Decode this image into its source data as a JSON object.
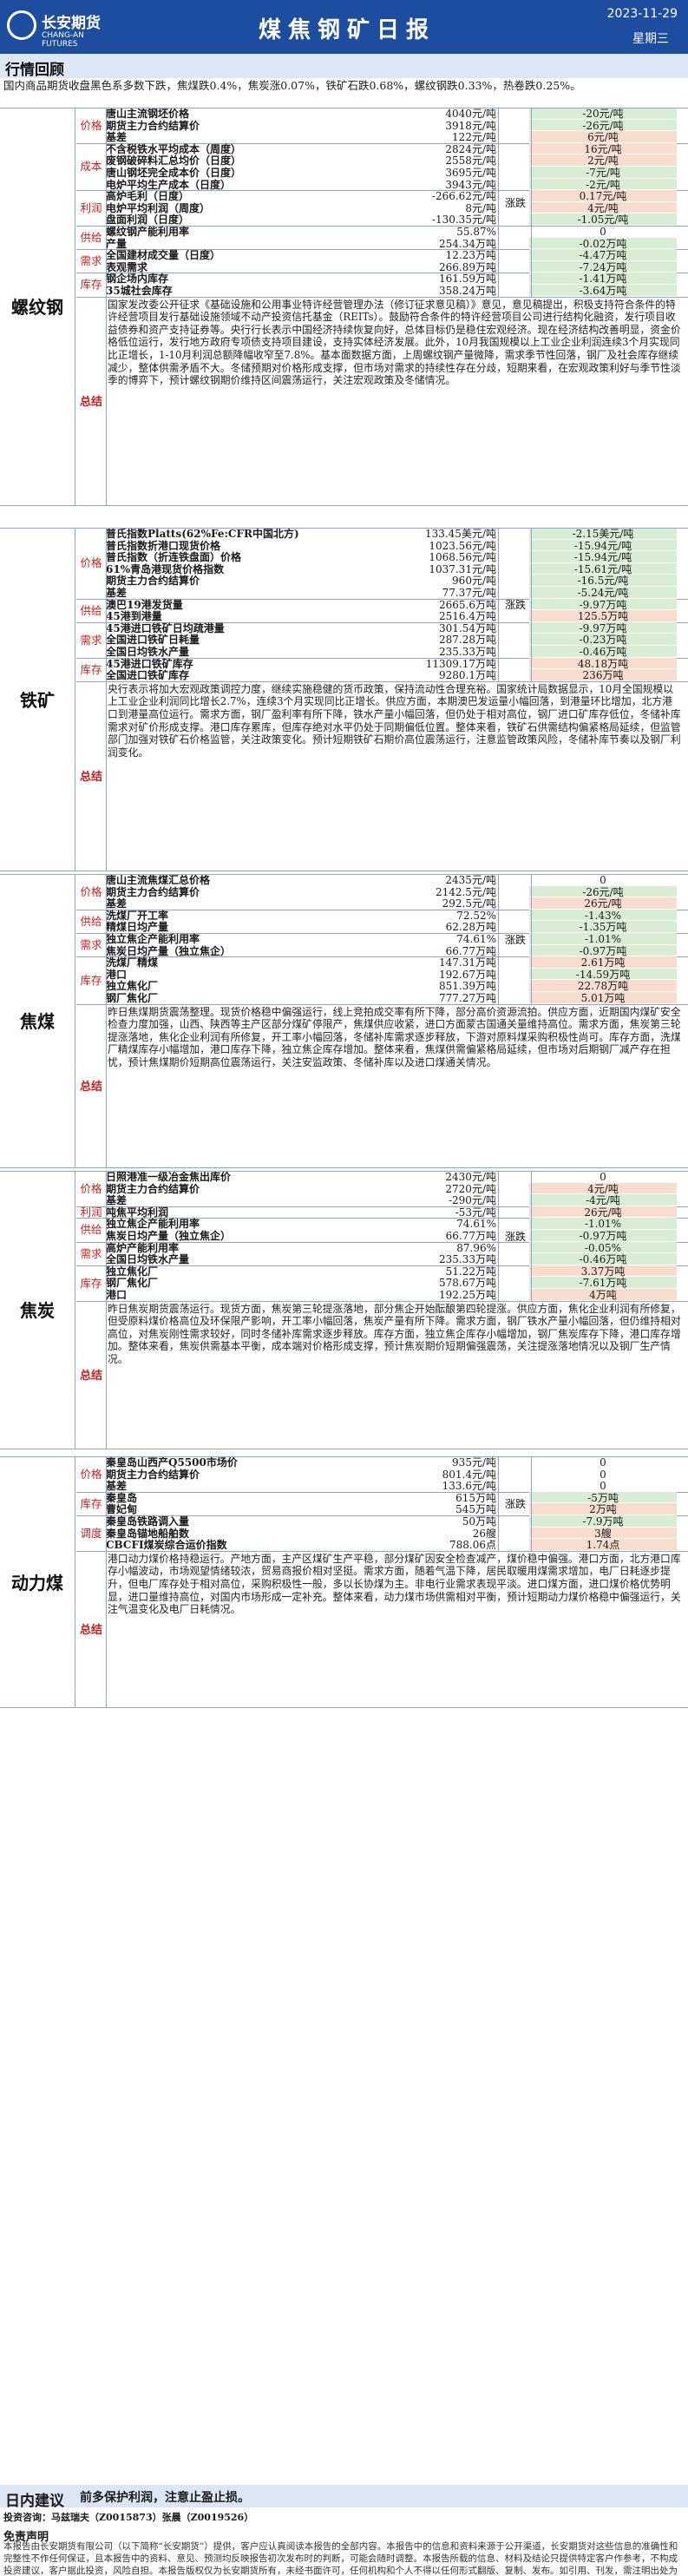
{
  "header": {
    "logo_cn": "长安期货",
    "logo_en": "CHANG-AN FUTURES",
    "title": "煤焦钢矿日报",
    "date": "2023-11-29",
    "weekday": "星期三"
  },
  "market_review": {
    "title": "行情回顾",
    "text": "国内商品期货收盘黑色系多数下跌，焦煤跌0.4%，焦炭涨0.07%，铁矿石跌0.68%，螺纹钢跌0.33%，热卷跌0.25%。"
  },
  "rebar": {
    "section": "螺纹钢",
    "rows": [
      {
        "cat": "价格",
        "label": "唐山主流钢坯价格",
        "value": "4040元/吨",
        "change": "-20元/吨"
      },
      {
        "cat": "价格",
        "label": "期货主力合约结算价",
        "value": "3918元/吨",
        "change": "-26元/吨"
      },
      {
        "cat": "价格",
        "label": "基差",
        "value": "122元/吨",
        "change": "6元/吨"
      },
      {
        "cat": "成本",
        "label": "不含税铁水平均成本（周度）",
        "value": "2824元/吨",
        "change": "16元/吨"
      },
      {
        "cat": "成本",
        "label": "废钢破碎料汇总均价（日度）",
        "value": "2558元/吨",
        "change": "2元/吨"
      },
      {
        "cat": "成本",
        "label": "唐山钢坯完全成本价（日度）",
        "value": "3695元/吨",
        "change": "-7元/吨"
      },
      {
        "cat": "成本",
        "label": "电炉平均生产成本（日度）",
        "value": "3943元/吨",
        "change": "-2元/吨"
      },
      {
        "cat": "利润",
        "label": "高炉毛利（日度）",
        "value": "-266.62元/吨",
        "change": "0.17元/吨"
      },
      {
        "cat": "利润",
        "label": "电炉平均利润（周度）",
        "value": "8元/吨",
        "change": "4元/吨"
      },
      {
        "cat": "利润",
        "label": "盘面利润（日度）",
        "value": "-130.35元/吨",
        "change": "-1.05元/吨"
      },
      {
        "cat": "供给",
        "label": "螺纹钢产能利用率",
        "value": "55.87%",
        "change": "0"
      },
      {
        "cat": "供给",
        "label": "产量",
        "value": "254.34万吨",
        "change": "-0.02万吨"
      },
      {
        "cat": "需求",
        "label": "全国建材成交量（日度）",
        "value": "12.23万吨",
        "change": "-4.47万吨"
      },
      {
        "cat": "需求",
        "label": "表观需求",
        "value": "266.89万吨",
        "change": "-7.24万吨"
      },
      {
        "cat": "库存",
        "label": "钢企场内库存",
        "value": "161.59万吨",
        "change": "-1.41万吨"
      },
      {
        "cat": "库存",
        "label": "35城社会库存",
        "value": "358.24万吨",
        "change": "-3.64万吨"
      }
    ],
    "updown": "涨跌",
    "summary_label": "总结",
    "summary": "国家发改委公开征求《基础设施和公用事业特许经营管理办法（修订征求意见稿）》意见，意见稿提出，积极支持符合条件的特许经营项目发行基础设施领域不动产投资信托基金（REITs）。鼓励符合条件的特许经营项目公司进行结构化融资，发行项目收益债券和资产支持证券等。央行行长表示中国经济持续恢复向好，总体目标仍是稳住宏观经济。现在经济结构改善明显，资金价格低位运行，发行地方政府专项债支持项目建设，支持实体经济发展。此外，10月我国规模以上工业企业利润连续3个月实现同比正增长，1-10月利润总额降幅收窄至7.8%。基本面数据方面，上周螺纹钢产量微降，需求季节性回落，钢厂及社会库存继续减少，整体供需矛盾不大。冬储预期对价格形成支撑，但市场对需求的持续性存在分歧，短期来看，在宏观政策利好与季节性淡季的博弈下，预计螺纹钢期价维持区间震荡运行，关注宏观政策及冬储情况。"
  },
  "iron": {
    "section": "铁矿",
    "rows": [
      {
        "cat": "价格",
        "label": "普氏指数Platts(62%Fe:CFR中国北方)",
        "value": "133.45美元/吨",
        "change": "-2.15美元/吨"
      },
      {
        "cat": "价格",
        "label": "普氏指数折港口现货价格",
        "value": "1023.56元/吨",
        "change": "-15.94元/吨"
      },
      {
        "cat": "价格",
        "label": "普氏指数（折连铁盘面）价格",
        "value": "1068.56元/吨",
        "change": "-15.94元/吨"
      },
      {
        "cat": "价格",
        "label": "61%青岛港现货价格指数",
        "value": "1037.31元/吨",
        "change": "-15.61元/吨"
      },
      {
        "cat": "价格",
        "label": "期货主力合约结算价",
        "value": "960元/吨",
        "change": "-16.5元/吨"
      },
      {
        "cat": "价格",
        "label": "基差",
        "value": "77.37元/吨",
        "change": "-5.24元/吨"
      },
      {
        "cat": "供给",
        "label": "澳巴19港发货量",
        "value": "2665.6万吨",
        "change": "-9.97万吨"
      },
      {
        "cat": "供给",
        "label": "45港到港量",
        "value": "2516.4万吨",
        "change": "125.5万吨"
      },
      {
        "cat": "需求",
        "label": "45港进口铁矿日均疏港量",
        "value": "301.54万吨",
        "change": "-9.97万吨"
      },
      {
        "cat": "需求",
        "label": "全国进口铁矿日耗量",
        "value": "287.28万吨",
        "change": "-0.23万吨"
      },
      {
        "cat": "需求",
        "label": "全国日均铁水产量",
        "value": "235.33万吨",
        "change": "-0.46万吨"
      },
      {
        "cat": "库存",
        "label": "45港进口铁矿库存",
        "value": "11309.17万吨",
        "change": "48.18万吨"
      },
      {
        "cat": "库存",
        "label": "全国进口铁矿库存",
        "value": "9280.1万吨",
        "change": "236万吨"
      }
    ],
    "updown": "涨跌",
    "summary_label": "总结",
    "summary": "央行表示将加大宏观政策调控力度，继续实施稳健的货币政策，保持流动性合理充裕。国家统计局数据显示，10月全国规模以上工业企业利润同比增长2.7%，连续3个月实现同比正增长。供应方面，本期澳巴发运量小幅回落，到港量环比增加，北方港口到港量高位运行。需求方面，钢厂盈利率有所下降，铁水产量小幅回落，但仍处于相对高位，钢厂进口矿库存低位，冬储补库需求对矿价形成支撑。港口库存累库，但库存绝对水平仍处于同期偏低位置。整体来看，铁矿石供需结构偏紧格局延续，但监管部门加强对铁矿石价格监管，关注政策变化。预计短期铁矿石期价高位震荡运行，注意监管政策风险，冬储补库节奏以及钢厂利润变化。"
  },
  "coke": {
    "section": "焦煤",
    "rows": [
      {
        "cat": "价格",
        "label": "唐山主流焦煤汇总价格",
        "value": "2435元/吨",
        "change": "0"
      },
      {
        "cat": "价格",
        "label": "期货主力合约结算价",
        "value": "2142.5元/吨",
        "change": "-26元/吨"
      },
      {
        "cat": "价格",
        "label": "基差",
        "value": "292.5元/吨",
        "change": "26元/吨"
      },
      {
        "cat": "供给",
        "label": "洗煤厂开工率",
        "value": "72.52%",
        "change": "-1.43%"
      },
      {
        "cat": "供给",
        "label": "精煤日均产量",
        "value": "62.28万吨",
        "change": "-1.35万吨"
      },
      {
        "cat": "需求",
        "label": "独立焦企产能利用率",
        "value": "74.61%",
        "change": "-1.01%"
      },
      {
        "cat": "需求",
        "label": "焦炭日均产量（独立焦企）",
        "value": "66.77万吨",
        "change": "-0.97万吨"
      },
      {
        "cat": "库存",
        "label": "洗煤厂精煤",
        "value": "147.31万吨",
        "change": "2.61万吨"
      },
      {
        "cat": "库存",
        "label": "港口",
        "value": "192.67万吨",
        "change": "-14.59万吨"
      },
      {
        "cat": "库存",
        "label": "独立焦化厂",
        "value": "851.39万吨",
        "change": "22.78万吨"
      },
      {
        "cat": "库存",
        "label": "钢厂焦化厂",
        "value": "777.27万吨",
        "change": "5.01万吨"
      }
    ],
    "updown": "涨跌",
    "summary_label": "总结",
    "summary": "昨日焦煤期货震荡整理。现货价格稳中偏强运行，线上竞拍成交率有所下降，部分高价资源流拍。供应方面，近期国内煤矿安全检查力度加强，山西、陕西等主产区部分煤矿停限产，焦煤供应收紧，进口方面蒙古国通关量维持高位。需求方面，焦炭第三轮提涨落地，焦化企业利润有所修复，开工率小幅回落，冬储补库需求逐步释放，下游对原料煤采购积极性尚可。库存方面，洗煤厂精煤库存小幅增加，港口库存下降，独立焦企库存增加。整体来看，焦煤供需偏紧格局延续，但市场对后期钢厂减产存在担忧，预计焦煤期价短期高位震荡运行，关注安监政策、冬储补库以及进口煤通关情况。"
  },
  "coal": {
    "section": "焦炭",
    "rows": [
      {
        "cat": "价格",
        "label": "日照港准一级冶金焦出库价",
        "value": "2430元/吨",
        "change": "0"
      },
      {
        "cat": "价格",
        "label": "期货主力合约结算价",
        "value": "2720元/吨",
        "change": "4元/吨"
      },
      {
        "cat": "价格",
        "label": "基差",
        "value": "-290元/吨",
        "change": "-4元/吨"
      },
      {
        "cat": "利润",
        "label": "吨焦平均利润",
        "value": "-53元/吨",
        "change": "26元/吨"
      },
      {
        "cat": "供给",
        "label": "独立焦企产能利用率",
        "value": "74.61%",
        "change": "-1.01%"
      },
      {
        "cat": "供给",
        "label": "焦炭日均产量（独立焦企）",
        "value": "66.77万吨",
        "change": "-0.97万吨"
      },
      {
        "cat": "需求",
        "label": "高炉产能利用率",
        "value": "87.96%",
        "change": "-0.05%"
      },
      {
        "cat": "需求",
        "label": "全国日均铁水产量",
        "value": "235.33万吨",
        "change": "-0.46万吨"
      },
      {
        "cat": "库存",
        "label": "独立焦化厂",
        "value": "51.22万吨",
        "change": "3.37万吨"
      },
      {
        "cat": "库存",
        "label": "钢厂焦化厂",
        "value": "578.67万吨",
        "change": "-7.61万吨"
      },
      {
        "cat": "库存",
        "label": "港口",
        "value": "192.25万吨",
        "change": "4万吨"
      }
    ],
    "updown": "涨跌",
    "summary_label": "总结",
    "summary": "昨日焦炭期货震荡运行。现货方面，焦炭第三轮提涨落地，部分焦企开始酝酿第四轮提涨。供应方面，焦化企业利润有所修复，但受原料煤价格高位及环保限产影响，开工率小幅回落，焦炭产量有所下降。需求方面，钢厂铁水产量小幅回落，但仍维持相对高位，对焦炭刚性需求较好，同时冬储补库需求逐步释放。库存方面，独立焦企库存小幅增加，钢厂焦炭库存下降，港口库存增加。整体来看，焦炭供需基本平衡，成本端对价格形成支撑，预计焦炭期价短期偏强震荡，关注提涨落地情况以及钢厂生产情况。"
  },
  "thermal": {
    "section": "动力煤",
    "rows": [
      {
        "cat": "价格",
        "label": "秦皇岛山西产Q5500市场价",
        "value": "935元/吨",
        "change": "0"
      },
      {
        "cat": "价格",
        "label": "期货主力合约结算价",
        "value": "801.4元/吨",
        "change": "0"
      },
      {
        "cat": "价格",
        "label": "基差",
        "value": "133.6元/吨",
        "change": "0"
      },
      {
        "cat": "库存",
        "label": "秦皇岛",
        "value": "615万吨",
        "change": "-5万吨"
      },
      {
        "cat": "库存",
        "label": "曹妃甸",
        "value": "545万吨",
        "change": "2万吨"
      },
      {
        "cat": "调度",
        "label": "秦皇岛铁路调入量",
        "value": "50万吨",
        "change": "-7.9万吨"
      },
      {
        "cat": "调度",
        "label": "秦皇岛锚地船舶数",
        "value": "26艘",
        "change": "3艘"
      },
      {
        "cat": "调度",
        "label": "CBCFI煤炭综合运价指数",
        "value": "788.06点",
        "change": "1.74点"
      }
    ],
    "updown": "涨跌",
    "summary_label": "总结",
    "summary": "港口动力煤价格持稳运行。产地方面，主产区煤矿生产平稳，部分煤矿因安全检查减产，煤价稳中偏强。港口方面，北方港口库存小幅波动，市场观望情绪较浓，贸易商报价相对坚挺。需求方面，随着气温下降，居民取暖用煤需求增加，电厂日耗逐步提升，但电厂库存处于相对高位，采购积极性一般，多以长协煤为主。非电行业需求表现平淡。进口煤方面，进口煤价格优势明显，进口量维持高位，对国内市场形成一定补充。整体来看，动力煤市场供需相对平衡，预计短期动力煤价格稳中偏强运行，关注气温变化及电厂日耗情况。"
  },
  "advice": {
    "title": "日内建议",
    "text": "前多保护利润，注意止盈止损。"
  },
  "author": "投资咨询：马兹瑞夫（Z0015873）张晨（Z0019526）",
  "disclaimer": {
    "title": "免责声明",
    "text": "本报告由长安期货有限公司（以下简称“长安期货”）提供，客户应认真阅读本报告的全部内容。本报告中的信息和资料来源于公开渠道，长安期货对这些信息的准确性和完整性不作任何保证，且本报告中的资料、意见、预测均反映报告初次发布时的判断，可能会随时调整。本报告所载的信息、材料及结论只提供特定客户作参考，不构成投资建议，客户据此投资，风险自担。本报告版权仅为长安期货所有，未经书面许可，任何机构和个人不得以任何形式翻版、复制、发布。如引用、刊发，需注明出处为长安期货，且不得对本报告进行有悖原意的引用、删节和修改。"
  }
}
